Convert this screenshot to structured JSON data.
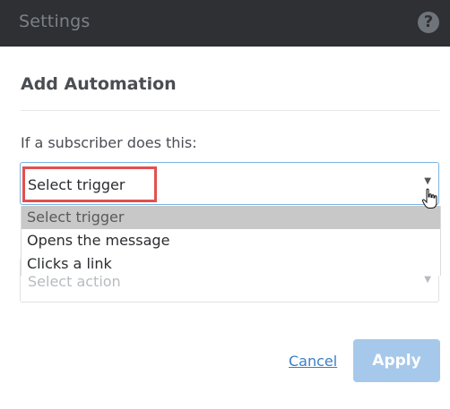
{
  "header": {
    "title": "Settings",
    "help_icon_label": "?"
  },
  "form": {
    "heading": "Add Automation",
    "trigger_label": "If a subscriber does this:",
    "trigger_select": {
      "value": "Select trigger",
      "options": [
        "Select trigger",
        "Opens the message",
        "Clicks a link"
      ],
      "highlighted_index": 0
    },
    "action_select": {
      "placeholder": "Select action"
    }
  },
  "footer": {
    "cancel_label": "Cancel",
    "apply_label": "Apply"
  },
  "colors": {
    "topbar_bg": "#2e3033",
    "accent": "#3b7fc4",
    "apply_disabled": "#a6c8ea",
    "highlight_box": "#e2504f"
  },
  "icons": {
    "help": "question-circle-icon",
    "dropdown_arrow": "caret-down-icon",
    "cursor": "hand-pointer-icon"
  }
}
